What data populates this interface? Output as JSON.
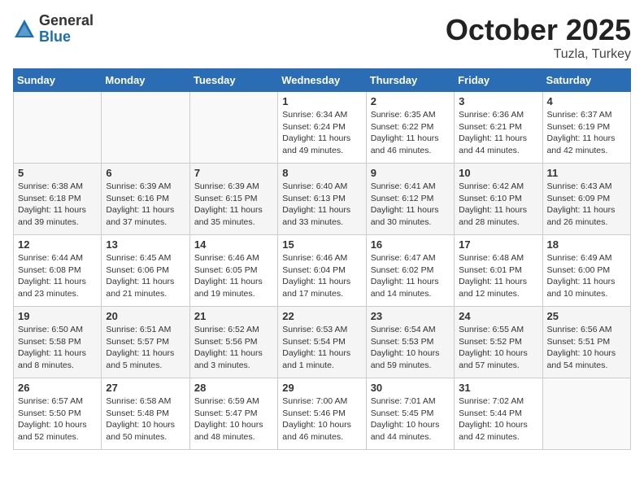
{
  "header": {
    "logo_general": "General",
    "logo_blue": "Blue",
    "month_title": "October 2025",
    "location": "Tuzla, Turkey"
  },
  "days_of_week": [
    "Sunday",
    "Monday",
    "Tuesday",
    "Wednesday",
    "Thursday",
    "Friday",
    "Saturday"
  ],
  "weeks": [
    [
      {
        "num": "",
        "info": ""
      },
      {
        "num": "",
        "info": ""
      },
      {
        "num": "",
        "info": ""
      },
      {
        "num": "1",
        "info": "Sunrise: 6:34 AM\nSunset: 6:24 PM\nDaylight: 11 hours\nand 49 minutes."
      },
      {
        "num": "2",
        "info": "Sunrise: 6:35 AM\nSunset: 6:22 PM\nDaylight: 11 hours\nand 46 minutes."
      },
      {
        "num": "3",
        "info": "Sunrise: 6:36 AM\nSunset: 6:21 PM\nDaylight: 11 hours\nand 44 minutes."
      },
      {
        "num": "4",
        "info": "Sunrise: 6:37 AM\nSunset: 6:19 PM\nDaylight: 11 hours\nand 42 minutes."
      }
    ],
    [
      {
        "num": "5",
        "info": "Sunrise: 6:38 AM\nSunset: 6:18 PM\nDaylight: 11 hours\nand 39 minutes."
      },
      {
        "num": "6",
        "info": "Sunrise: 6:39 AM\nSunset: 6:16 PM\nDaylight: 11 hours\nand 37 minutes."
      },
      {
        "num": "7",
        "info": "Sunrise: 6:39 AM\nSunset: 6:15 PM\nDaylight: 11 hours\nand 35 minutes."
      },
      {
        "num": "8",
        "info": "Sunrise: 6:40 AM\nSunset: 6:13 PM\nDaylight: 11 hours\nand 33 minutes."
      },
      {
        "num": "9",
        "info": "Sunrise: 6:41 AM\nSunset: 6:12 PM\nDaylight: 11 hours\nand 30 minutes."
      },
      {
        "num": "10",
        "info": "Sunrise: 6:42 AM\nSunset: 6:10 PM\nDaylight: 11 hours\nand 28 minutes."
      },
      {
        "num": "11",
        "info": "Sunrise: 6:43 AM\nSunset: 6:09 PM\nDaylight: 11 hours\nand 26 minutes."
      }
    ],
    [
      {
        "num": "12",
        "info": "Sunrise: 6:44 AM\nSunset: 6:08 PM\nDaylight: 11 hours\nand 23 minutes."
      },
      {
        "num": "13",
        "info": "Sunrise: 6:45 AM\nSunset: 6:06 PM\nDaylight: 11 hours\nand 21 minutes."
      },
      {
        "num": "14",
        "info": "Sunrise: 6:46 AM\nSunset: 6:05 PM\nDaylight: 11 hours\nand 19 minutes."
      },
      {
        "num": "15",
        "info": "Sunrise: 6:46 AM\nSunset: 6:04 PM\nDaylight: 11 hours\nand 17 minutes."
      },
      {
        "num": "16",
        "info": "Sunrise: 6:47 AM\nSunset: 6:02 PM\nDaylight: 11 hours\nand 14 minutes."
      },
      {
        "num": "17",
        "info": "Sunrise: 6:48 AM\nSunset: 6:01 PM\nDaylight: 11 hours\nand 12 minutes."
      },
      {
        "num": "18",
        "info": "Sunrise: 6:49 AM\nSunset: 6:00 PM\nDaylight: 11 hours\nand 10 minutes."
      }
    ],
    [
      {
        "num": "19",
        "info": "Sunrise: 6:50 AM\nSunset: 5:58 PM\nDaylight: 11 hours\nand 8 minutes."
      },
      {
        "num": "20",
        "info": "Sunrise: 6:51 AM\nSunset: 5:57 PM\nDaylight: 11 hours\nand 5 minutes."
      },
      {
        "num": "21",
        "info": "Sunrise: 6:52 AM\nSunset: 5:56 PM\nDaylight: 11 hours\nand 3 minutes."
      },
      {
        "num": "22",
        "info": "Sunrise: 6:53 AM\nSunset: 5:54 PM\nDaylight: 11 hours\nand 1 minute."
      },
      {
        "num": "23",
        "info": "Sunrise: 6:54 AM\nSunset: 5:53 PM\nDaylight: 10 hours\nand 59 minutes."
      },
      {
        "num": "24",
        "info": "Sunrise: 6:55 AM\nSunset: 5:52 PM\nDaylight: 10 hours\nand 57 minutes."
      },
      {
        "num": "25",
        "info": "Sunrise: 6:56 AM\nSunset: 5:51 PM\nDaylight: 10 hours\nand 54 minutes."
      }
    ],
    [
      {
        "num": "26",
        "info": "Sunrise: 6:57 AM\nSunset: 5:50 PM\nDaylight: 10 hours\nand 52 minutes."
      },
      {
        "num": "27",
        "info": "Sunrise: 6:58 AM\nSunset: 5:48 PM\nDaylight: 10 hours\nand 50 minutes."
      },
      {
        "num": "28",
        "info": "Sunrise: 6:59 AM\nSunset: 5:47 PM\nDaylight: 10 hours\nand 48 minutes."
      },
      {
        "num": "29",
        "info": "Sunrise: 7:00 AM\nSunset: 5:46 PM\nDaylight: 10 hours\nand 46 minutes."
      },
      {
        "num": "30",
        "info": "Sunrise: 7:01 AM\nSunset: 5:45 PM\nDaylight: 10 hours\nand 44 minutes."
      },
      {
        "num": "31",
        "info": "Sunrise: 7:02 AM\nSunset: 5:44 PM\nDaylight: 10 hours\nand 42 minutes."
      },
      {
        "num": "",
        "info": ""
      }
    ]
  ]
}
